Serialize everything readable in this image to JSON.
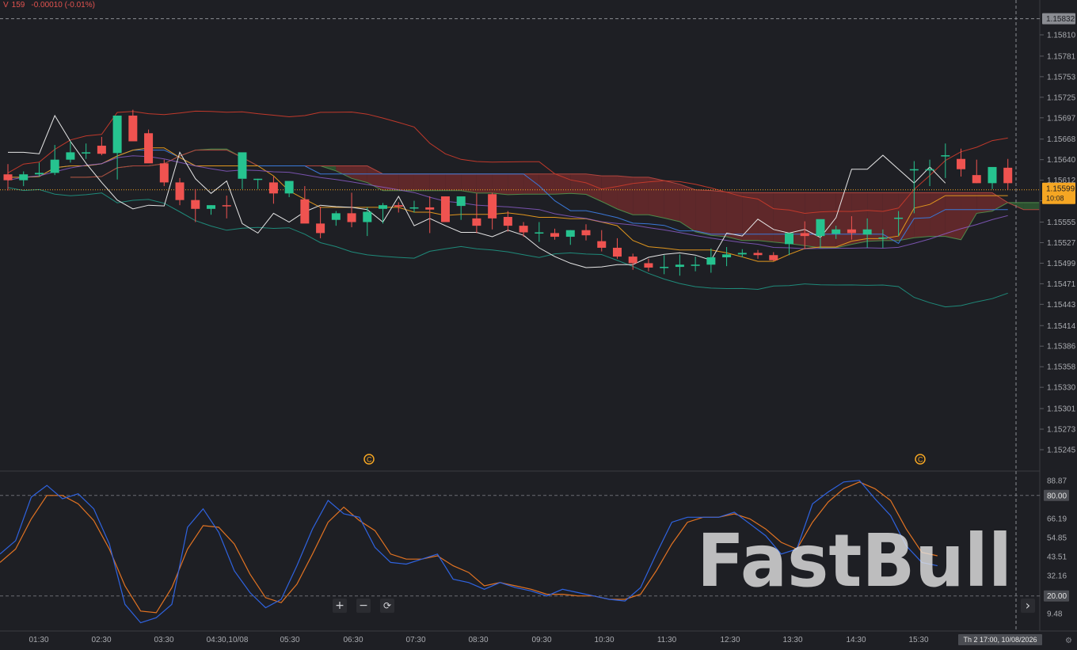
{
  "header": {
    "symbol_flag": "V",
    "volume": "159",
    "change": "-0.00010 (-0.01%)"
  },
  "price_axis": {
    "ticks": [
      "1.15810",
      "1.15781",
      "1.15753",
      "1.15725",
      "1.15697",
      "1.15668",
      "1.15640",
      "1.15612",
      "1.15584",
      "1.15555",
      "1.15527",
      "1.15499",
      "1.15471",
      "1.15443",
      "1.15414",
      "1.15386",
      "1.15358",
      "1.15330",
      "1.15301",
      "1.15273",
      "1.15245"
    ],
    "high_marker": "1.15832",
    "last_price": "1.15599",
    "countdown": "10:08"
  },
  "time_axis": {
    "labels": [
      "01:30",
      "02:30",
      "03:30",
      "04:30,10/08",
      "05:30",
      "06:30",
      "07:30",
      "08:30",
      "09:30",
      "10:30",
      "11:30",
      "12:30",
      "13:30",
      "14:30",
      "15:30"
    ],
    "crosshair_label": "Th 2 17:00, 10/08/2026"
  },
  "oscillator_axis": {
    "ticks": [
      "88.87",
      "66.19",
      "54.85",
      "43.51",
      "32.16",
      "9.48"
    ],
    "upper_level": "80.00",
    "lower_level": "20.00"
  },
  "controls": {
    "zoom_in": "+",
    "zoom_out": "−",
    "reset": "⟳",
    "scroll_right": "›"
  },
  "watermark": "FastBull",
  "colors": {
    "background": "#1e1f24",
    "up": "#26c38f",
    "down": "#ef5350",
    "k_line": "#2f63e0",
    "d_line": "#e27322",
    "cloud_bear": "#6b2a2c",
    "cloud_bull": "#2f5a32",
    "last_price": "#f5a623"
  },
  "chart_data": [
    {
      "type": "candlestick",
      "title": "",
      "ylim": [
        1.15225,
        1.15846
      ],
      "x": [
        "00:30",
        "00:45",
        "01:00",
        "01:15",
        "01:30",
        "01:45",
        "02:00",
        "02:15",
        "02:30",
        "02:45",
        "03:00",
        "03:15",
        "03:30",
        "03:45",
        "04:00",
        "04:15",
        "04:30",
        "04:45",
        "05:00",
        "05:15",
        "05:30",
        "05:45",
        "06:00",
        "06:15",
        "06:30",
        "06:45",
        "07:00",
        "07:15",
        "07:30",
        "07:45",
        "08:00",
        "08:15",
        "08:30",
        "08:45",
        "09:00",
        "09:15",
        "09:30",
        "09:45",
        "10:00",
        "10:15",
        "10:30",
        "10:45",
        "11:00",
        "11:15",
        "11:30",
        "11:45",
        "12:00",
        "12:15",
        "12:30",
        "12:45",
        "13:00",
        "13:15",
        "13:30",
        "13:45",
        "14:00",
        "14:15",
        "14:30",
        "14:45",
        "15:00",
        "15:15",
        "15:30",
        "15:45",
        "16:00",
        "16:15",
        "16:30"
      ],
      "open": [
        1.1562,
        1.15612,
        1.1562,
        1.15622,
        1.1564,
        1.1565,
        1.15659,
        1.15649,
        1.157,
        1.15676,
        1.15635,
        1.15609,
        1.15585,
        1.15573,
        1.15578,
        1.15614,
        1.15614,
        1.15609,
        1.15594,
        1.15586,
        1.15553,
        1.15558,
        1.15567,
        1.15555,
        1.15573,
        1.15578,
        1.15574,
        1.15575,
        1.1559,
        1.15577,
        1.1556,
        1.15593,
        1.15562,
        1.1555,
        1.15541,
        1.1554,
        1.15535,
        1.15544,
        1.15529,
        1.1552,
        1.15508,
        1.15499,
        1.15493,
        1.15494,
        1.15497,
        1.15497,
        1.15507,
        1.15511,
        1.15513,
        1.1551,
        1.15525,
        1.1554,
        1.15536,
        1.15539,
        1.15545,
        1.15538,
        1.15534,
        1.15561,
        1.15627,
        1.15627,
        1.15646,
        1.15641,
        1.15619,
        1.15608,
        1.15629
      ],
      "high": [
        1.15634,
        1.15624,
        1.15636,
        1.1566,
        1.15665,
        1.15662,
        1.15671,
        1.15692,
        1.15708,
        1.15681,
        1.1564,
        1.15615,
        1.156,
        1.15578,
        1.15591,
        1.15614,
        1.15614,
        1.15617,
        1.15602,
        1.15604,
        1.15576,
        1.1557,
        1.15595,
        1.15575,
        1.15581,
        1.15582,
        1.15584,
        1.1559,
        1.1559,
        1.1559,
        1.15594,
        1.15595,
        1.1557,
        1.15555,
        1.15555,
        1.15546,
        1.15544,
        1.15552,
        1.15544,
        1.15533,
        1.15512,
        1.15505,
        1.1551,
        1.15511,
        1.15508,
        1.15519,
        1.15521,
        1.15518,
        1.15517,
        1.15514,
        1.1554,
        1.15556,
        1.15548,
        1.1555,
        1.15563,
        1.1556,
        1.15545,
        1.1557,
        1.15638,
        1.1564,
        1.15662,
        1.15655,
        1.1564,
        1.15628,
        1.15641
      ],
      "low": [
        1.15598,
        1.15604,
        1.15617,
        1.15619,
        1.15636,
        1.15641,
        1.15646,
        1.15613,
        1.1568,
        1.15652,
        1.15604,
        1.15578,
        1.15555,
        1.15565,
        1.1556,
        1.156,
        1.156,
        1.1558,
        1.15589,
        1.1558,
        1.15533,
        1.1555,
        1.15548,
        1.15536,
        1.15553,
        1.15568,
        1.15568,
        1.1554,
        1.15562,
        1.15558,
        1.1554,
        1.15545,
        1.15542,
        1.15535,
        1.15528,
        1.15531,
        1.15524,
        1.1553,
        1.15515,
        1.15505,
        1.1549,
        1.15488,
        1.15484,
        1.15482,
        1.15488,
        1.15486,
        1.15495,
        1.15507,
        1.15505,
        1.15502,
        1.1551,
        1.15518,
        1.1552,
        1.15532,
        1.15531,
        1.1552,
        1.1552,
        1.15536,
        1.15567,
        1.15604,
        1.15615,
        1.15617,
        1.15608,
        1.156,
        1.15599
      ],
      "close": [
        1.15612,
        1.1562,
        1.15622,
        1.1564,
        1.1565,
        1.1565,
        1.15648,
        1.157,
        1.15665,
        1.15635,
        1.15609,
        1.15585,
        1.15573,
        1.15578,
        1.15577,
        1.1565,
        1.15614,
        1.15594,
        1.15611,
        1.15553,
        1.1554,
        1.15567,
        1.15555,
        1.15569,
        1.15578,
        1.15576,
        1.15575,
        1.15572,
        1.15555,
        1.1559,
        1.1555,
        1.1556,
        1.1555,
        1.15541,
        1.15541,
        1.15535,
        1.15544,
        1.15537,
        1.1552,
        1.15508,
        1.15499,
        1.15493,
        1.15494,
        1.15497,
        1.15497,
        1.15507,
        1.15511,
        1.15513,
        1.1551,
        1.15503,
        1.1554,
        1.15536,
        1.15559,
        1.15545,
        1.1554,
        1.15545,
        1.15534,
        1.15561,
        1.15627,
        1.15627,
        1.15646,
        1.15627,
        1.15608,
        1.1563,
        1.15608
      ]
    },
    {
      "type": "line",
      "title": "",
      "ylim": [
        0,
        100
      ],
      "levels": [
        20,
        80
      ],
      "x": [
        "00:30",
        "00:45",
        "01:00",
        "01:15",
        "01:30",
        "01:45",
        "02:00",
        "02:15",
        "02:30",
        "02:45",
        "03:00",
        "03:15",
        "03:30",
        "03:45",
        "04:00",
        "04:15",
        "04:30",
        "04:45",
        "05:00",
        "05:15",
        "05:30",
        "05:45",
        "06:00",
        "06:15",
        "06:30",
        "06:45",
        "07:00",
        "07:15",
        "07:30",
        "07:45",
        "08:00",
        "08:15",
        "08:30",
        "08:45",
        "09:00",
        "09:15",
        "09:30",
        "09:45",
        "10:00",
        "10:15",
        "10:30",
        "10:45",
        "11:00",
        "11:15",
        "11:30",
        "11:45",
        "12:00",
        "12:15",
        "12:30",
        "12:45",
        "13:00",
        "13:15",
        "13:30",
        "13:45",
        "14:00",
        "14:15",
        "14:30",
        "14:45",
        "15:00",
        "15:15",
        "15:30",
        "15:45",
        "16:00",
        "16:15",
        "16:30"
      ],
      "series": [
        {
          "values": [
            45,
            53,
            79,
            86,
            78,
            81,
            72,
            51,
            15,
            4,
            7,
            15,
            61,
            72,
            58,
            35,
            22,
            13,
            18,
            38,
            60,
            77,
            69,
            67,
            49,
            40,
            39,
            42,
            45,
            30,
            28,
            24,
            28,
            25,
            23,
            20,
            24,
            22,
            20,
            18,
            17,
            25,
            45,
            64,
            67,
            67,
            67,
            70,
            63,
            56,
            45,
            48,
            75,
            82,
            88,
            89,
            78,
            68,
            50,
            40,
            38
          ]
        },
        {
          "values": [
            40,
            48,
            66,
            80,
            80,
            75,
            65,
            48,
            26,
            11,
            10,
            25,
            48,
            62,
            61,
            51,
            33,
            19,
            16,
            27,
            45,
            64,
            73,
            65,
            59,
            45,
            42,
            42,
            44,
            38,
            34,
            26,
            28,
            26,
            24,
            21,
            21,
            20,
            20,
            18,
            18,
            21,
            35,
            51,
            64,
            67,
            67,
            69,
            66,
            60,
            52,
            48,
            64,
            76,
            84,
            88,
            84,
            77,
            60,
            46,
            44
          ]
        }
      ]
    }
  ]
}
